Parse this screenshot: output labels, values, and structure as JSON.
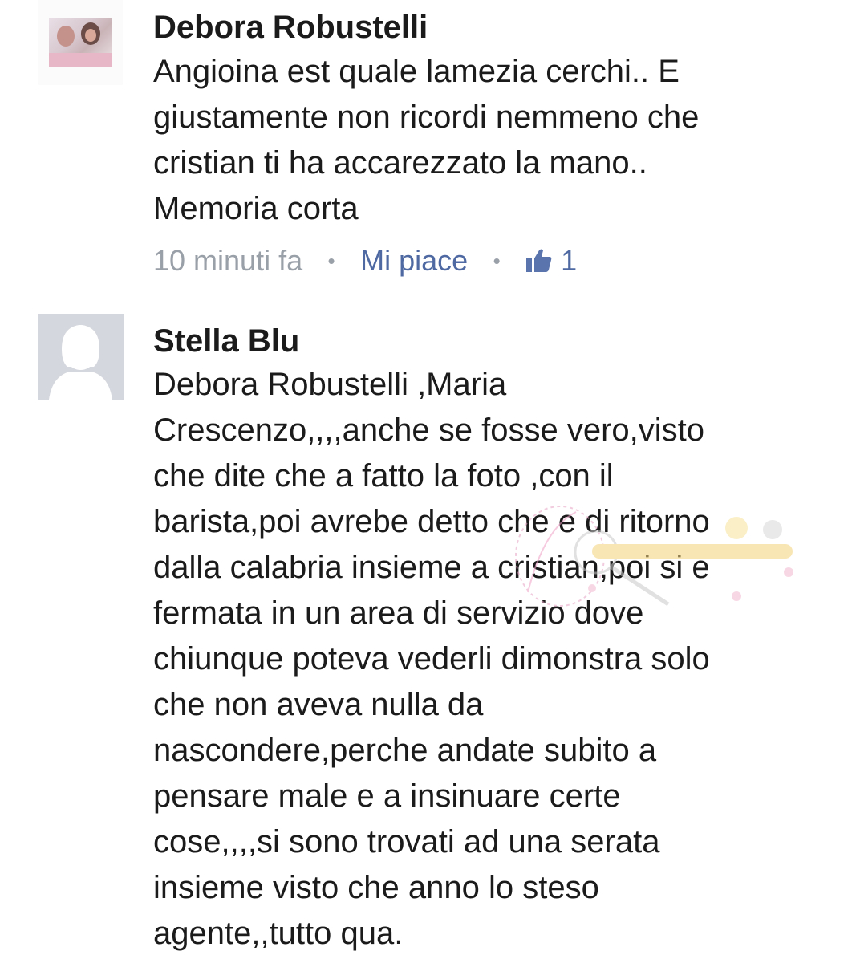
{
  "comments": [
    {
      "author": "Debora Robustelli",
      "avatar": "profile-photo",
      "text_lines": [
        "Angioina est quale lamezia cerchi.. E",
        "giustamente non ricordi nemmeno che",
        "cristian ti ha accarezzato la mano..",
        "Memoria corta"
      ],
      "time": "10 minuti fa",
      "separator": "•",
      "like_label": "Mi piace",
      "like_count": "1",
      "like_icon": "thumbs-up-icon"
    },
    {
      "author": "Stella Blu",
      "avatar": "default-profile-silhouette",
      "text_lines": [
        "Debora Robustelli ,Maria",
        "Crescenzo,,,,anche se fosse vero,visto",
        "che dite che a fatto la foto ,con il",
        "barista,poi avrebe detto che e di ritorno",
        "dalla calabria insieme a cristian,poi si e",
        "fermata in un area di servizio dove",
        "chiunque poteva vederli dimonstra solo",
        "che non aveva nulla da",
        "nascondere,perche andate subito a",
        "pensare male e a insinuare certe",
        "cose,,,,si sono trovati ad una serata",
        "insieme visto che anno lo steso",
        "agente,,tutto qua."
      ]
    }
  ],
  "colors": {
    "text": "#1b1b1b",
    "meta_gray": "#9aa0a8",
    "link_blue": "#4f6aa3",
    "avatar_placeholder": "#d5d7de"
  }
}
